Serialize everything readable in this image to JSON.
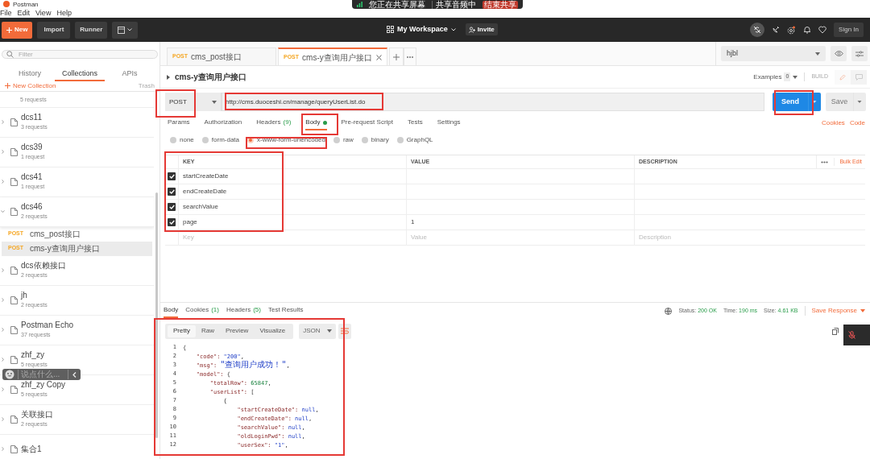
{
  "screen_share_bar": {
    "status": "您正在共享屏幕",
    "audio": "共享音频中",
    "stop_button": "结束共享"
  },
  "window": {
    "title": "Postman"
  },
  "menu": [
    "File",
    "Edit",
    "View",
    "Help"
  ],
  "header": {
    "new_button": "New",
    "import_button": "Import",
    "runner_button": "Runner",
    "workspace": "My Workspace",
    "invite_button": "Invite",
    "sign_in_button": "Sign In"
  },
  "sidebar": {
    "filter_placeholder": "Filter",
    "tabs": [
      {
        "label": "History",
        "selected": false
      },
      {
        "label": "Collections",
        "selected": true
      },
      {
        "label": "APIs",
        "selected": false
      }
    ],
    "new_collection": "New Collection",
    "trash": "Trash",
    "collections": [
      {
        "count": "5 requests",
        "expanded": false
      },
      {
        "name": "dcs11",
        "count": "3 requests",
        "expanded": false
      },
      {
        "name": "dcs39",
        "count": "1 request",
        "expanded": false
      },
      {
        "name": "dcs41",
        "count": "1 request",
        "expanded": false
      },
      {
        "name": "dcs46",
        "count": "2 requests",
        "expanded": true,
        "children": [
          {
            "method": "POST",
            "name": "cms_post接口",
            "selected": false
          },
          {
            "method": "POST",
            "name": "cms-y查询用户接口",
            "selected": true
          }
        ]
      },
      {
        "name": "dcs依赖接口",
        "count": "2 requests",
        "expanded": false
      },
      {
        "name": "jh",
        "count": "2 requests",
        "expanded": false
      },
      {
        "name": "Postman Echo",
        "count": "37 requests",
        "expanded": false
      },
      {
        "name": "zhf_zy",
        "count": "5 requests",
        "expanded": false
      },
      {
        "name": "zhf_zy Copy",
        "count": "5 requests",
        "expanded": false
      },
      {
        "name": "关联接口",
        "count": "2 requests",
        "expanded": false
      },
      {
        "name": "集合1",
        "expanded": false
      }
    ]
  },
  "comment_widget": {
    "placeholder": "说点什么..."
  },
  "request_tabs": [
    {
      "method": "POST",
      "name": "cms_post接口",
      "selected": false
    },
    {
      "method": "POST",
      "name": "cms-y查询用户接口",
      "selected": true
    }
  ],
  "environment": "hjbl",
  "request": {
    "name": "cms-y查询用户接口",
    "examples_label": "Examples",
    "examples_count": "0",
    "build": "BUILD",
    "method": "POST",
    "url": "http://cms.duoceshi.cn/manage/queryUserList.do",
    "send_button": "Send",
    "save_button": "Save",
    "tabs": [
      {
        "label": "Params",
        "selected": false
      },
      {
        "label": "Authorization",
        "selected": false
      },
      {
        "label": "Headers",
        "count": "(9)",
        "selected": false
      },
      {
        "label": "Body",
        "dot": true,
        "selected": true
      },
      {
        "label": "Pre-request Script",
        "selected": false
      },
      {
        "label": "Tests",
        "selected": false
      },
      {
        "label": "Settings",
        "selected": false
      }
    ],
    "links": [
      "Cookies",
      "Code"
    ],
    "body_modes": [
      {
        "label": "none",
        "selected": false
      },
      {
        "label": "form-data",
        "selected": false
      },
      {
        "label": "x-www-form-urlencoded",
        "selected": true
      },
      {
        "label": "raw",
        "selected": false
      },
      {
        "label": "binary",
        "selected": false
      },
      {
        "label": "GraphQL",
        "selected": false
      }
    ],
    "table": {
      "columns": [
        "KEY",
        "VALUE",
        "DESCRIPTION"
      ],
      "bulk_edit": "Bulk Edit",
      "rows": [
        {
          "key": "startCreateDate",
          "checked": true
        },
        {
          "key": "endCreateDate",
          "checked": true
        },
        {
          "key": "searchValue",
          "checked": true
        },
        {
          "key": "page",
          "value": "1",
          "checked": true
        }
      ],
      "new_row": {
        "key": "Key",
        "value": "Value",
        "description": "Description"
      }
    }
  },
  "response": {
    "tabs": [
      {
        "label": "Body",
        "selected": true
      },
      {
        "label": "Cookies",
        "count": "(1)",
        "selected": false
      },
      {
        "label": "Headers",
        "count": "(5)",
        "selected": false
      },
      {
        "label": "Test Results",
        "selected": false
      }
    ],
    "status_label": "Status:",
    "status": "200 OK",
    "time_label": "Time:",
    "time": "190 ms",
    "size_label": "Size:",
    "size": "4.61 KB",
    "save_response": "Save Response",
    "view_modes": [
      {
        "label": "Pretty",
        "selected": true
      },
      {
        "label": "Raw",
        "selected": false
      },
      {
        "label": "Preview",
        "selected": false
      },
      {
        "label": "Visualize",
        "selected": false
      }
    ],
    "format": "JSON",
    "code_lines": [
      {
        "number": "1",
        "text": "{"
      },
      {
        "number": "2",
        "text": "    \"code\": \"200\","
      },
      {
        "number": "3",
        "text": "    \"msg\": \"查询用户成功！\","
      },
      {
        "number": "4",
        "text": "    \"model\": {"
      },
      {
        "number": "5",
        "text": "        \"totalRow\": 65847,"
      },
      {
        "number": "6",
        "text": "        \"userList\": ["
      },
      {
        "number": "7",
        "text": "            {"
      },
      {
        "number": "8",
        "text": "                \"startCreateDate\": null,"
      },
      {
        "number": "9",
        "text": "                \"endCreateDate\": null,"
      },
      {
        "number": "10",
        "text": "                \"searchValue\": null,"
      },
      {
        "number": "11",
        "text": "                \"oldLoginPwd\": null,"
      },
      {
        "number": "12",
        "text": "                \"userSex\": \"1\","
      }
    ]
  }
}
